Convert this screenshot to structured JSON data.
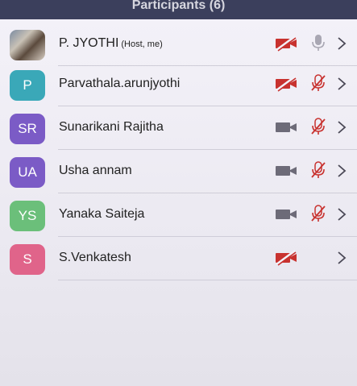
{
  "header": {
    "title": "Participants (6)"
  },
  "colors": {
    "avatar_teal": "#3aa8b8",
    "avatar_purple": "#7b5bc6",
    "avatar_green": "#6bbf7a",
    "avatar_pink": "#e0648a",
    "muted_red": "#c8322f",
    "icon_gray": "#6d6b78"
  },
  "participants": [
    {
      "name": "P. JYOTHI",
      "tag": "(Host, me)",
      "initials": "",
      "avatar": "photo",
      "camera": "video-off-icon",
      "mic": "mic-on-icon"
    },
    {
      "name": "Parvathala.arunjyothi",
      "tag": "",
      "initials": "P",
      "avatar": "teal",
      "camera": "video-off-icon",
      "mic": "mic-muted-icon"
    },
    {
      "name": "Sunarikani Rajitha",
      "tag": "",
      "initials": "SR",
      "avatar": "purple",
      "camera": "video-on-icon",
      "mic": "mic-muted-icon"
    },
    {
      "name": "Usha annam",
      "tag": "",
      "initials": "UA",
      "avatar": "purple",
      "camera": "video-on-icon",
      "mic": "mic-muted-icon"
    },
    {
      "name": "Yanaka Saiteja",
      "tag": "",
      "initials": "YS",
      "avatar": "green",
      "camera": "video-on-icon",
      "mic": "mic-muted-icon"
    },
    {
      "name": "S.Venkatesh",
      "tag": "",
      "initials": "S",
      "avatar": "pink",
      "camera": "video-off-icon",
      "mic": ""
    }
  ]
}
